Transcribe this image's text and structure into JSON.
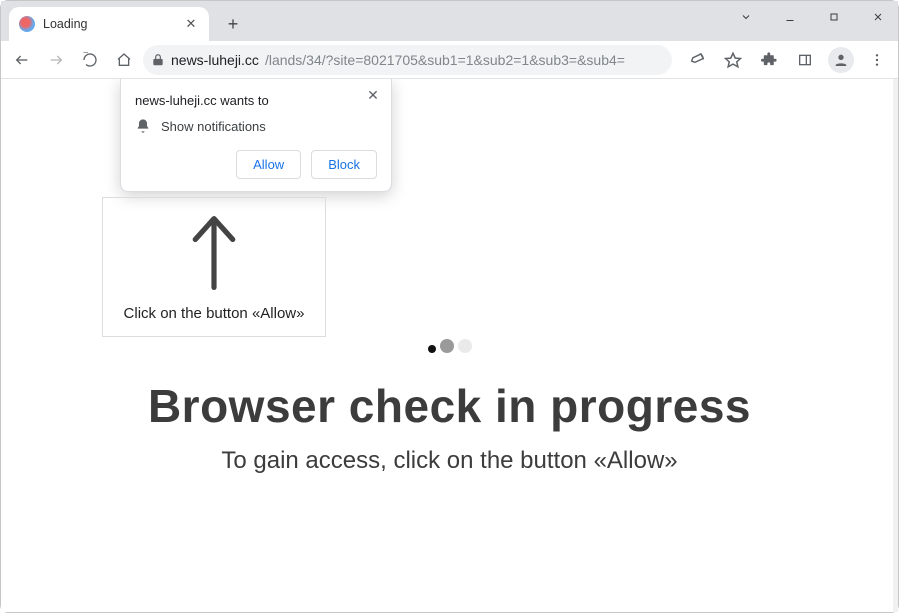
{
  "window": {
    "tab_title": "Loading"
  },
  "address": {
    "domain": "news-luheji.cc",
    "path": "/lands/34/?site=8021705&sub1=1&sub2=1&sub3=&sub4="
  },
  "permission_popup": {
    "title": "news-luheji.cc wants to",
    "request": "Show notifications",
    "allow_label": "Allow",
    "block_label": "Block"
  },
  "instruction_box": {
    "text": "Click on the button «Allow»"
  },
  "hero": {
    "heading": "Browser check in progress",
    "subheading": "To gain access, click on the button «Allow»"
  }
}
